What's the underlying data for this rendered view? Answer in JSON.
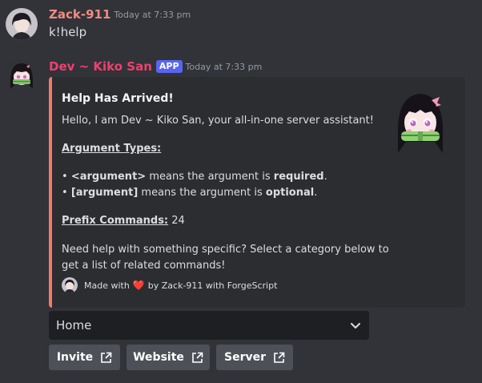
{
  "message1": {
    "username": "Zack-911",
    "username_color": "#f28b82",
    "timestamp": "Today at 7:33 pm",
    "content": "k!help"
  },
  "message2": {
    "username": "Dev ~ Kiko San",
    "username_color": "#f23f6f",
    "badge": "APP",
    "timestamp": "Today at 7:33 pm"
  },
  "embed": {
    "accent_color": "#f57a63",
    "title": "Help Has Arrived!",
    "intro": "Hello, I am Dev ~ Kiko San, your all-in-one server assistant!",
    "argument_types_heading": "Argument Types:",
    "arg1_bullet": "•",
    "arg1_code": "<argument>",
    "arg1_text": "means the argument is",
    "arg1_emph": "required",
    "arg1_end": ".",
    "arg2_bullet": "•",
    "arg2_code": "[argument]",
    "arg2_text": "means the argument is",
    "arg2_emph": "optional",
    "arg2_end": ".",
    "prefix_label": "Prefix Commands:",
    "prefix_count": "24",
    "help_line1": "Need help with something specific? Select a category below to",
    "help_line2": "get a list of related commands!",
    "footer_made": "Made with",
    "footer_heart": "❤️",
    "footer_by": "by Zack-911 with ForgeScript"
  },
  "select": {
    "value": "Home",
    "icon": "chevron-down-icon"
  },
  "buttons": [
    {
      "label": "Invite",
      "icon": "external-link-icon"
    },
    {
      "label": "Website",
      "icon": "external-link-icon"
    },
    {
      "label": "Server",
      "icon": "external-link-icon"
    }
  ]
}
